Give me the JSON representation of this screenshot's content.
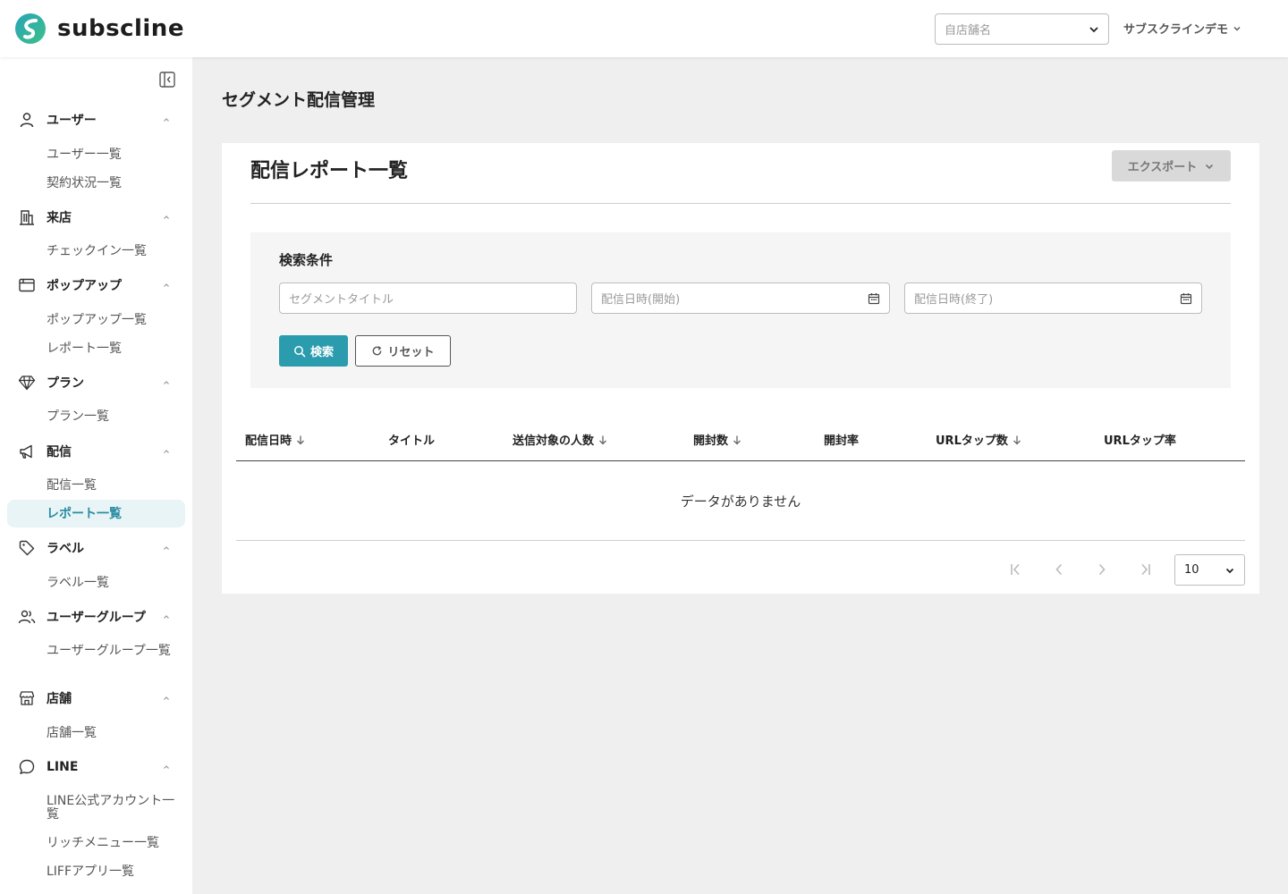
{
  "header": {
    "logo_text": "subscline",
    "store_select_placeholder": "自店舗名",
    "account_name": "サブスクラインデモ"
  },
  "sidebar": {
    "sections": [
      {
        "label": "ユーザー",
        "icon": "user-icon",
        "items": [
          "ユーザー一覧",
          "契約状況一覧"
        ]
      },
      {
        "label": "来店",
        "icon": "building-icon",
        "items": [
          "チェックイン一覧"
        ]
      },
      {
        "label": "ポップアップ",
        "icon": "window-icon",
        "items": [
          "ポップアップ一覧",
          "レポート一覧"
        ]
      },
      {
        "label": "プラン",
        "icon": "diamond-icon",
        "items": [
          "プラン一覧"
        ]
      },
      {
        "label": "配信",
        "icon": "megaphone-icon",
        "items": [
          "配信一覧",
          "レポート一覧"
        ]
      },
      {
        "label": "ラベル",
        "icon": "tag-icon",
        "items": [
          "ラベル一覧"
        ]
      },
      {
        "label": "ユーザーグループ",
        "icon": "users-icon",
        "items": [
          "ユーザーグループ一覧"
        ]
      },
      {
        "label": "店舗",
        "icon": "store-icon",
        "items": [
          "店舗一覧"
        ]
      },
      {
        "label": "LINE",
        "icon": "chat-bubble-icon",
        "items": [
          "LINE公式アカウント一覧",
          "リッチメニュー一覧",
          "LIFFアプリ一覧"
        ]
      }
    ],
    "active_item": "配信 / レポート一覧"
  },
  "main": {
    "page_title": "セグメント配信管理",
    "card_title": "配信レポート一覧",
    "export_label": "エクスポート",
    "search": {
      "title": "検索条件",
      "title_placeholder": "セグメントタイトル",
      "start_placeholder": "配信日時(開始)",
      "end_placeholder": "配信日時(終了)",
      "search_label": "検索",
      "reset_label": "リセット"
    },
    "table": {
      "columns": [
        "配信日時",
        "タイトル",
        "送信対象の人数",
        "開封数",
        "開封率",
        "URLタップ数",
        "URLタップ率"
      ],
      "empty_text": "データがありません"
    },
    "pagination": {
      "page_size": "10"
    }
  },
  "colors": {
    "accent": "#2a9cae",
    "active_nav_text": "#2a8ca3",
    "active_nav_bg": "#e8f4f6",
    "background": "#efefef"
  }
}
